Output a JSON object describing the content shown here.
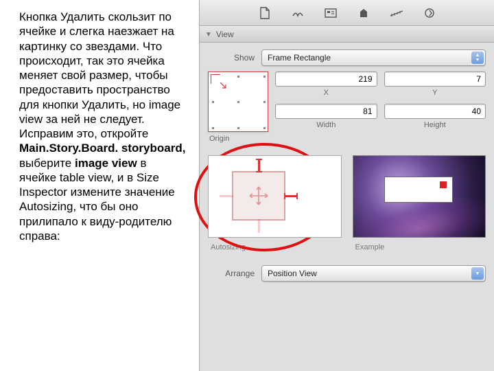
{
  "text": {
    "p1": "Кнопка Удалить скользит по ячейке и слегка наезжает на картинку со звездами. Что происходит, так это ячейка меняет свой размер, чтобы предоставить пространство для кнопки Удалить, но image view за ней не следует. Исправим это, откройте ",
    "b1": "Main.Story.Board. storyboard,",
    "p2": " выберите ",
    "b2": "image view",
    "p3": " в ячейке table view, и в Size Inspector измените значение Autosizing, что бы оно прилипало к виду-родителю справа:"
  },
  "section": {
    "view": "View"
  },
  "labels": {
    "show": "Show",
    "origin": "Origin",
    "x": "X",
    "y": "Y",
    "width": "Width",
    "height": "Height",
    "autosizing": "Autosizing",
    "example": "Example",
    "arrange": "Arrange"
  },
  "values": {
    "show": "Frame Rectangle",
    "x": "219",
    "y": "7",
    "width": "81",
    "height": "40",
    "arrange": "Position View"
  }
}
